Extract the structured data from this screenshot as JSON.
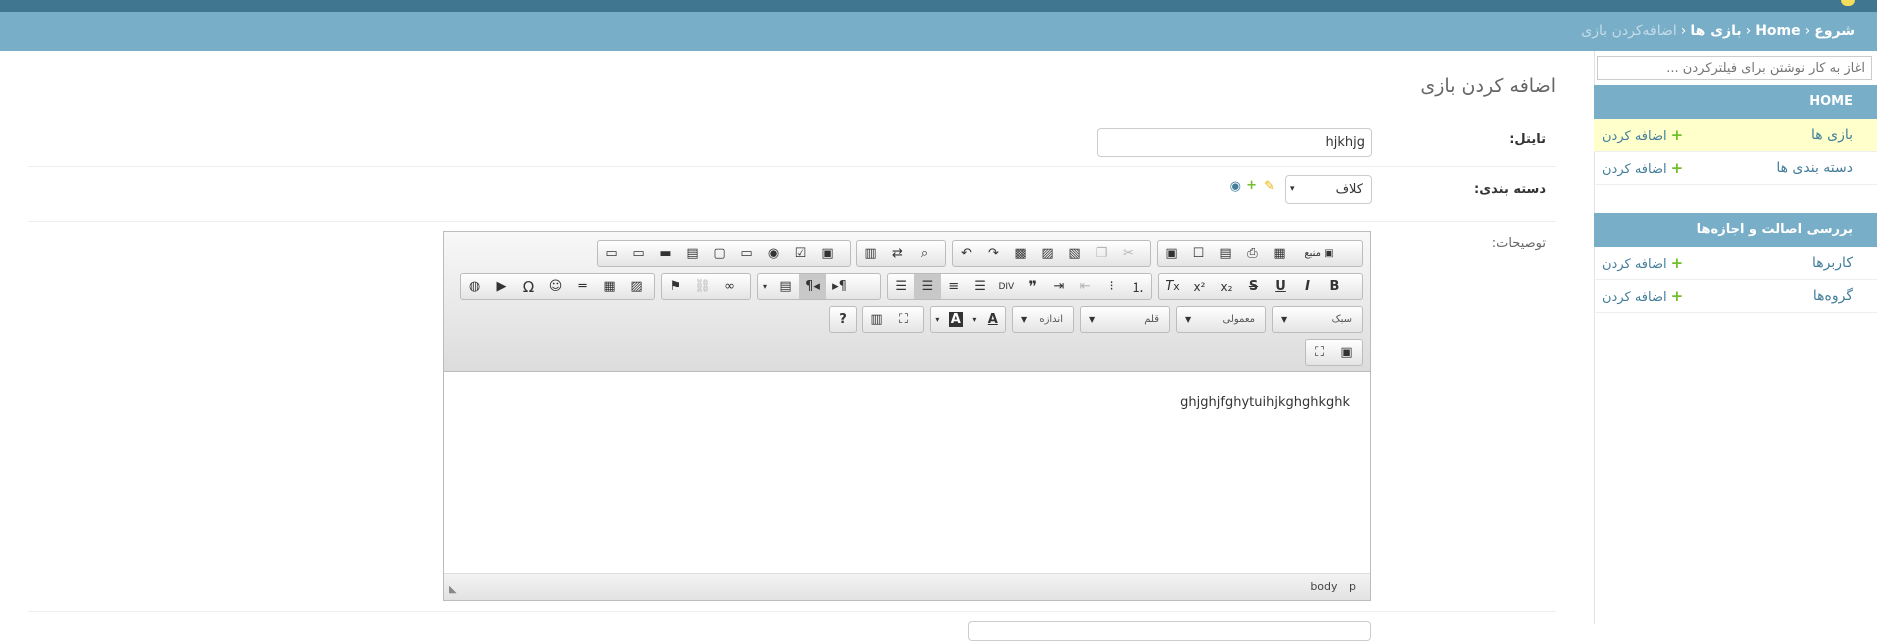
{
  "breadcrumbs": {
    "home_fa": "شروع",
    "home_en": "Home",
    "games": "بازی ها",
    "current": "اضافه‌کردن بازی"
  },
  "sidebar": {
    "filter_placeholder": "آغاز به کار نوشتن برای فیلترکردن ...",
    "module1": {
      "caption": "HOME",
      "rows": [
        {
          "name": "بازی ها",
          "add": "اضافه کردن"
        },
        {
          "name": "دسته بندی ها",
          "add": "اضافه کردن"
        }
      ]
    },
    "module2": {
      "caption": "بررسی اصالت و اجازه‌ها",
      "rows": [
        {
          "name": "کاربرها",
          "add": "اضافه کردن"
        },
        {
          "name": "گروه‌ها",
          "add": "اضافه کردن"
        }
      ]
    }
  },
  "page_title": "اضافه کردن بازی",
  "form": {
    "title_label": "تایتل:",
    "title_value": "hjkhjg",
    "category_label": "دسته بندی:",
    "category_value": "کلاف",
    "description_label": "توصیحات:"
  },
  "editor": {
    "source_label": "منبع",
    "style_combo": "سبک",
    "format_combo": "معمولی",
    "font_combo": "قلم",
    "size_combo": "اندازه",
    "content": "ghjghjfghytuihjkghghkghk",
    "path": "body p"
  },
  "colors": {
    "header": "#417690",
    "breadcrumb": "#79aec8",
    "link": "#447e9b",
    "add_plus": "#70bf2b",
    "active_row": "#ffffcc"
  }
}
